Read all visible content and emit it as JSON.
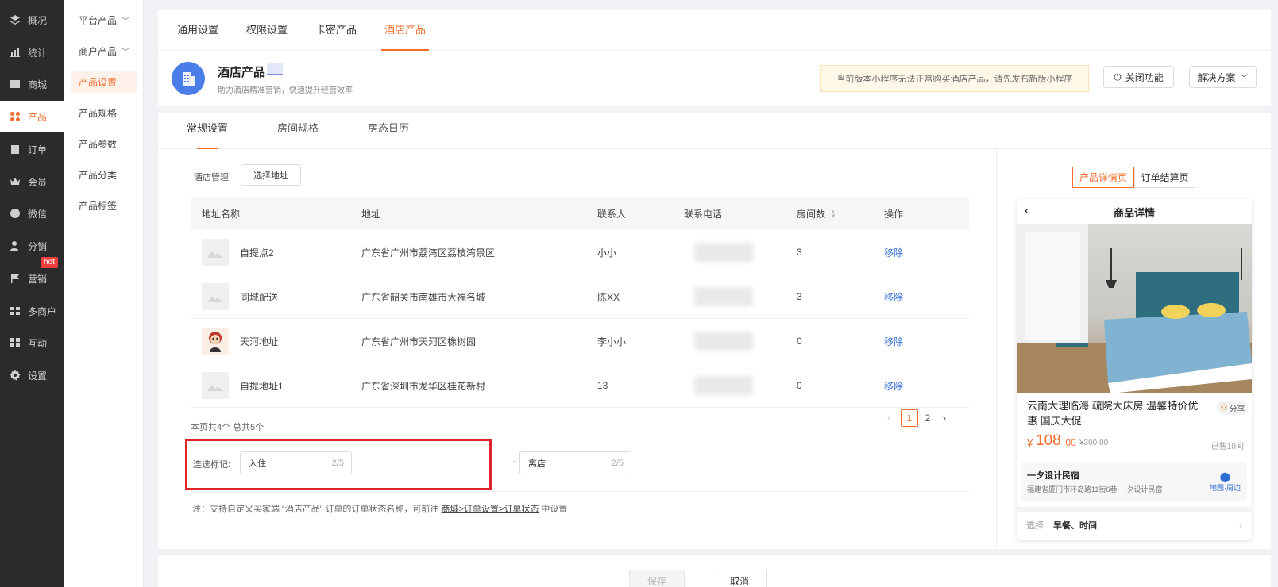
{
  "sidebar": {
    "items": [
      {
        "label": "概况",
        "icon": "layers-icon"
      },
      {
        "label": "统计",
        "icon": "chart-icon"
      },
      {
        "label": "商城",
        "icon": "shop-icon"
      },
      {
        "label": "产品",
        "icon": "grid-icon",
        "active": true
      },
      {
        "label": "订单",
        "icon": "clipboard-icon"
      },
      {
        "label": "会员",
        "icon": "crown-icon"
      },
      {
        "label": "微信",
        "icon": "wechat-icon"
      },
      {
        "label": "分销",
        "icon": "user-share-icon"
      },
      {
        "label": "营销",
        "icon": "flag-icon",
        "badge": "hot"
      },
      {
        "label": "多商户",
        "icon": "store-icon"
      },
      {
        "label": "互动",
        "icon": "interact-icon"
      },
      {
        "label": "设置",
        "icon": "gear-icon"
      }
    ]
  },
  "submenu": {
    "items": [
      {
        "label": "平台产品",
        "chevron": "﹀"
      },
      {
        "label": "商户产品",
        "chevron": "﹀"
      },
      {
        "label": "产品设置",
        "active": true
      },
      {
        "label": "产品规格"
      },
      {
        "label": "产品参数"
      },
      {
        "label": "产品分类"
      },
      {
        "label": "产品标签"
      }
    ]
  },
  "top_tabs": [
    "通用设置",
    "权限设置",
    "卡密产品",
    "酒店产品"
  ],
  "header": {
    "title": "酒店产品",
    "desc": "助力酒店精准营销，快速提升经营效率",
    "warning": "当前版本小程序无法正常购买酒店产品，请先发布新版小程序",
    "close_btn": "关闭功能",
    "solution_btn": "解决方案"
  },
  "inner_tabs": [
    "常规设置",
    "房间规格",
    "房态日历"
  ],
  "hotel_manage": {
    "label": "酒店管理:",
    "select_btn": "选择地址"
  },
  "table": {
    "headers": [
      "地址名称",
      "地址",
      "联系人",
      "联系电话",
      "房间数",
      "操作"
    ],
    "rows": [
      {
        "name": "自提点2",
        "address": "广东省广州市荔湾区荔枝湾景区",
        "contact": "小小",
        "rooms": "3",
        "action": "移除"
      },
      {
        "name": "同城配送",
        "address": "广东省韶关市南雄市大福名城",
        "contact": "陈XX",
        "rooms": "3",
        "action": "移除"
      },
      {
        "name": "天河地址",
        "address": "广东省广州市天河区橡树园",
        "contact": "李小小",
        "rooms": "0",
        "action": "移除"
      },
      {
        "name": "自提地址1",
        "address": "广东省深圳市龙华区桂花新村",
        "contact": "13",
        "rooms": "0",
        "action": "移除"
      }
    ]
  },
  "summary": "本页共4个 总共5个",
  "pagination": {
    "prev": "‹",
    "pages": [
      "1",
      "2"
    ],
    "next": "›"
  },
  "mark": {
    "label": "连选标记:",
    "checkin": {
      "value": "入住",
      "count": "2/5"
    },
    "separator": "-",
    "checkout": {
      "value": "离店",
      "count": "2/5"
    }
  },
  "note": {
    "prefix": "注：支持自定义买家端 “酒店产品” 订单的订单状态名称，可前往",
    "link": "商城>订单设置>订单状态",
    "suffix": "中设置"
  },
  "preview": {
    "tabs": [
      "产品详情页",
      "订单结算页"
    ],
    "header": "商品详情",
    "back": "‹",
    "room_title": "云南大理临海 疏院大床房 温馨特价优惠 国庆大促",
    "share": "分享",
    "currency": "¥",
    "price_int": "108",
    "price_dec": ".00",
    "price_old": "¥300.00",
    "sold": "已售10间",
    "shop_name": "一夕设计民宿",
    "shop_addr": "福建省厦门市环岛路11街6巷·一夕设计民宿",
    "map_label": "地图·周边",
    "option_key": "选择",
    "option_value": "早餐、时间"
  },
  "bottom": {
    "save": "保存",
    "cancel": "取消"
  },
  "colors": {
    "accent": "#f56e2d",
    "link": "#2f6dd6",
    "sidebar_bg": "#2b2b2b",
    "highlight_border": "#e0242b"
  }
}
